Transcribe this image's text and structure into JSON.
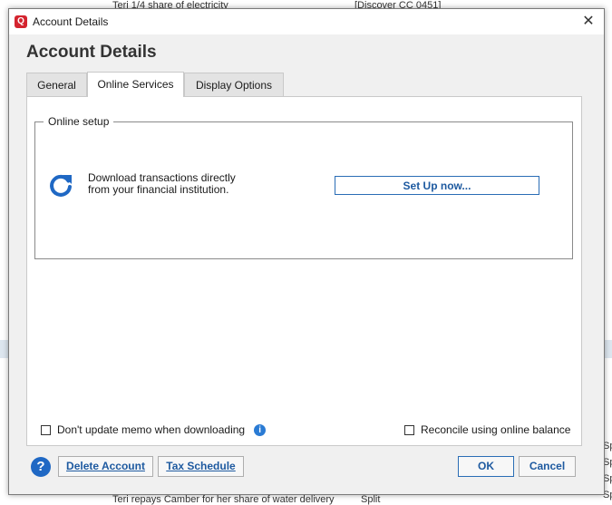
{
  "background": {
    "rows": [
      {
        "desc": "Teri 1/4 share of electricity",
        "category": "[Discover CC 0451]"
      },
      {
        "desc": "Teri repays Camber for her share of water delivery",
        "category": "Split"
      }
    ],
    "right_edge": [
      "Sp",
      "Sp",
      "Sp",
      "Sp"
    ]
  },
  "window": {
    "title": "Account Details",
    "app_icon": "Q",
    "close_glyph": "✕"
  },
  "heading": "Account Details",
  "tabs": [
    {
      "label": "General"
    },
    {
      "label": "Online Services",
      "active": true
    },
    {
      "label": "Display Options"
    }
  ],
  "online_setup": {
    "legend": "Online setup",
    "icon": "refresh-icon",
    "description": "Download transactions directly from your financial institution.",
    "setup_button": "Set Up now..."
  },
  "options": {
    "dont_update_memo": {
      "label": "Don't update memo when downloading",
      "checked": false
    },
    "reconcile_online": {
      "label": "Reconcile using online balance",
      "checked": false
    }
  },
  "footer": {
    "help_glyph": "?",
    "delete_account": "Delete Account",
    "tax_schedule": "Tax Schedule",
    "ok": "OK",
    "cancel": "Cancel"
  },
  "colors": {
    "accent": "#1e5aa0",
    "brand": "#d4242f",
    "info": "#2a7bd4"
  }
}
